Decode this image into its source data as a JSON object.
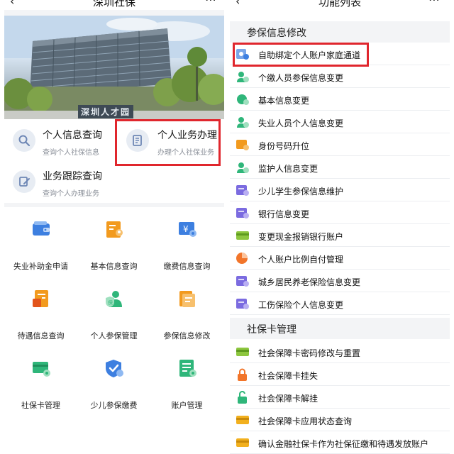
{
  "left": {
    "nav": {
      "back_icon": "chevron-left-icon",
      "title": "深圳社保",
      "more_icon": "more-icon"
    },
    "banner": {
      "sign": "深圳人才园"
    },
    "quick": [
      {
        "title": "个人信息查询",
        "sub": "查询个人社保信息",
        "icon": "search-icon"
      },
      {
        "title": "个人业务办理",
        "sub": "办理个人社保业务",
        "icon": "document-icon"
      },
      {
        "title": "业务跟踪查询",
        "sub": "查询个人办理业务",
        "icon": "pencil-icon"
      }
    ],
    "grid": [
      {
        "label": "失业补助金申请",
        "icon": "wallet-icon"
      },
      {
        "label": "基本信息查询",
        "icon": "profile-card-icon"
      },
      {
        "label": "缴费信息查询",
        "icon": "yen-card-icon"
      },
      {
        "label": "待遇信息查询",
        "icon": "checklist-icon"
      },
      {
        "label": "个人参保管理",
        "icon": "person-shield-icon"
      },
      {
        "label": "参保信息修改",
        "icon": "edit-document-icon"
      },
      {
        "label": "社保卡管理",
        "icon": "card-gear-icon"
      },
      {
        "label": "少儿参保缴费",
        "icon": "shield-child-icon"
      },
      {
        "label": "账户管理",
        "icon": "account-list-icon"
      }
    ]
  },
  "right": {
    "nav": {
      "back_icon": "close-icon",
      "title": "功能列表",
      "more_icon": "more-icon"
    },
    "sections": [
      {
        "title": "参保信息修改",
        "items": [
          "自助绑定个人账户家庭通道",
          "个缴人员参保信息变更",
          "基本信息变更",
          "失业人员个人信息变更",
          "身份号码升位",
          "监护人信息变更",
          "少儿学生参保信息维护",
          "银行信息变更",
          "变更现金报销银行账户",
          "个人账户比例自付管理",
          "城乡居民养老保险信息变更",
          "工伤保险个人信息变更"
        ]
      },
      {
        "title": "社保卡管理",
        "items": [
          "社会保障卡密码修改与重置",
          "社会保障卡挂失",
          "社会保障卡解挂",
          "社会保障卡应用状态查询",
          "确认金融社保卡作为社保征缴和待遇发放账户"
        ]
      }
    ]
  },
  "colors": {
    "highlight": "#e0262d",
    "icon_blue": "#3d7fe0",
    "icon_orange": "#f29a1e",
    "icon_green": "#2fb67a",
    "icon_purple": "#7b6be0"
  }
}
